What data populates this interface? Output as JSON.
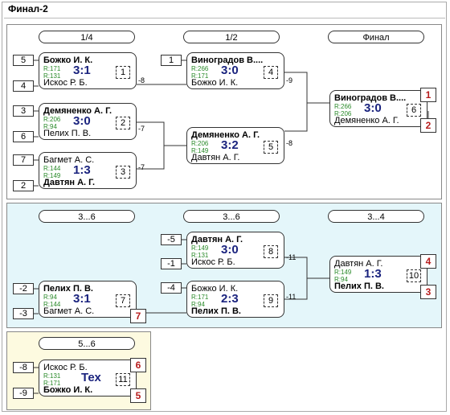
{
  "title": "Финал-2",
  "rounds": [
    "1/4",
    "1/2",
    "Финал",
    "3...6",
    "3...6",
    "3...4",
    "5...6"
  ],
  "seeds": [
    "5",
    "4",
    "3",
    "6",
    "7",
    "2",
    "1",
    "-5",
    "-1",
    "-2",
    "-3",
    "-4",
    "-8",
    "-9"
  ],
  "matches": [
    {
      "p1": "Божко И. К.",
      "r1": "R:171",
      "p2": "Искос Р. Б.",
      "r2": "R:131",
      "score": "3:1",
      "num": "1",
      "winner": 1
    },
    {
      "p1": "Демяненко А. Г.",
      "r1": "R:206",
      "p2": "Пелих П. В.",
      "r2": "R:94",
      "score": "3:0",
      "num": "2",
      "winner": 1
    },
    {
      "p1": "Багмет А. С.",
      "r1": "R:144",
      "p2": "Давтян А. Г.",
      "r2": "R:149",
      "score": "1:3",
      "num": "3",
      "winner": 2
    },
    {
      "p1": "Виноградов В....",
      "r1": "R:266",
      "p2": "Божко И. К.",
      "r2": "R:171",
      "score": "3:0",
      "num": "4",
      "winner": 1
    },
    {
      "p1": "Демяненко А. Г.",
      "r1": "R:206",
      "p2": "Давтян А. Г.",
      "r2": "R:149",
      "score": "3:2",
      "num": "5",
      "winner": 1
    },
    {
      "p1": "Виноградов В....",
      "r1": "R:266",
      "p2": "Демяненко А. Г.",
      "r2": "R:206",
      "score": "3:0",
      "num": "6",
      "winner": 1
    },
    {
      "p1": "Пелих П. В.",
      "r1": "R:94",
      "p2": "Багмет А. С.",
      "r2": "R:144",
      "score": "3:1",
      "num": "7",
      "winner": 1
    },
    {
      "p1": "Давтян А. Г.",
      "r1": "R:149",
      "p2": "Искос Р. Б.",
      "r2": "R:131",
      "score": "3:0",
      "num": "8",
      "winner": 1
    },
    {
      "p1": "Божко И. К.",
      "r1": "R:171",
      "p2": "Пелих П. В.",
      "r2": "R:94",
      "score": "2:3",
      "num": "9",
      "winner": 2
    },
    {
      "p1": "Давтян А. Г.",
      "r1": "R:149",
      "p2": "Пелих П. В.",
      "r2": "R:94",
      "score": "1:3",
      "num": "10",
      "winner": 2
    },
    {
      "p1": "Искос Р. Б.",
      "r1": "R:131",
      "p2": "Божко И. К.",
      "r2": "R:171",
      "score": "Тех",
      "num": "11",
      "winner": 2
    }
  ],
  "loser_labels": [
    "-8",
    "-7",
    "-7",
    "-9",
    "-8",
    "-11",
    "-11"
  ],
  "places": [
    "1",
    "2",
    "7",
    "4",
    "3",
    "6",
    "5"
  ]
}
